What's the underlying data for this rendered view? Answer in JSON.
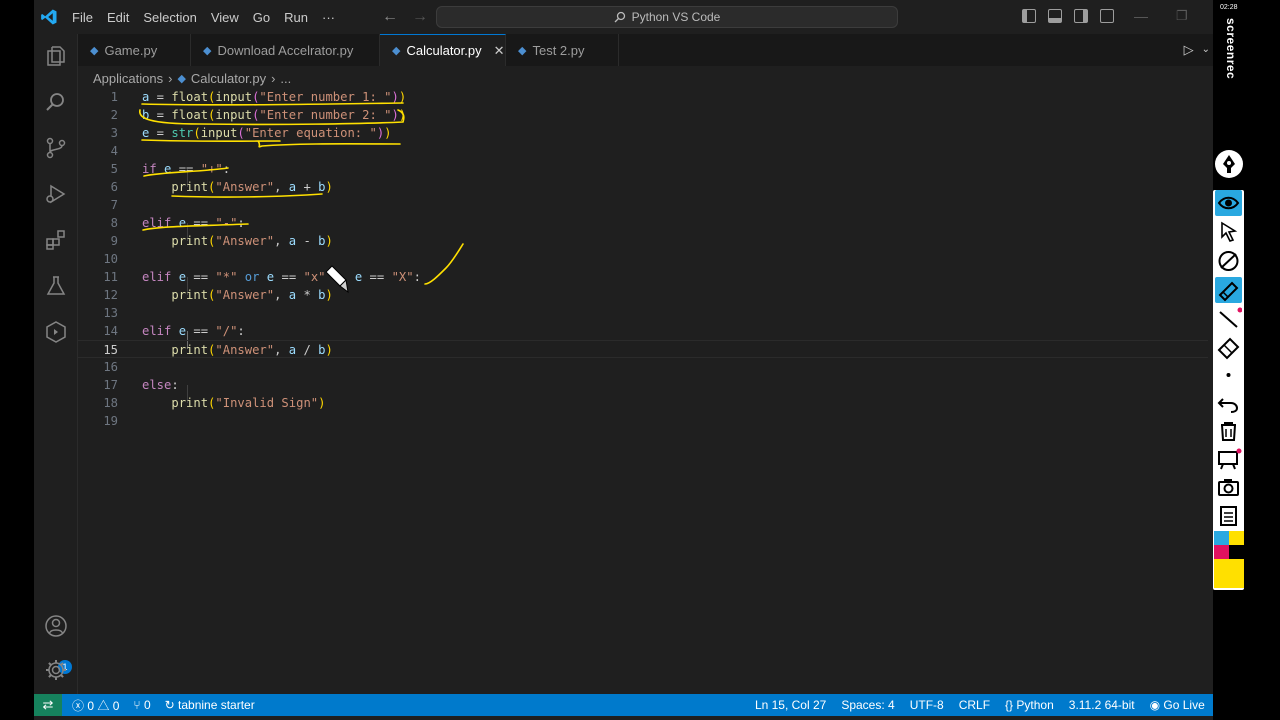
{
  "window": {
    "menu": [
      "File",
      "Edit",
      "Selection",
      "View",
      "Go",
      "Run",
      "···"
    ],
    "search_text": "Python VS Code"
  },
  "tabs": [
    {
      "label": "Game.py",
      "active": false
    },
    {
      "label": "Download Accelrator.py",
      "active": false
    },
    {
      "label": "Calculator.py",
      "active": true
    },
    {
      "label": "Test 2.py",
      "active": false
    }
  ],
  "breadcrumb": {
    "folder": "Applications",
    "file": "Calculator.py",
    "more": "..."
  },
  "editor": {
    "line_numbers": [
      "1",
      "2",
      "3",
      "4",
      "5",
      "6",
      "7",
      "8",
      "9",
      "10",
      "11",
      "12",
      "13",
      "14",
      "15",
      "16",
      "17",
      "18",
      "19"
    ],
    "current_line": 15
  },
  "statusbar": {
    "errors": "0",
    "warnings": "0",
    "ports": "0",
    "tabnine": "tabnine starter",
    "position": "Ln 15, Col 27",
    "spaces": "Spaces: 4",
    "encoding": "UTF-8",
    "eol": "CRLF",
    "language": "Python",
    "interpreter": "3.11.2 64-bit",
    "golive": "Go Live"
  },
  "activity": {
    "accounts_badge": "1"
  },
  "screenrec": {
    "label": "screenrec",
    "time": "02:28"
  },
  "colors": {
    "accent": "#0078d4",
    "statusbar": "#007acc",
    "remote": "#16825d",
    "annotation": "#ffe000"
  }
}
